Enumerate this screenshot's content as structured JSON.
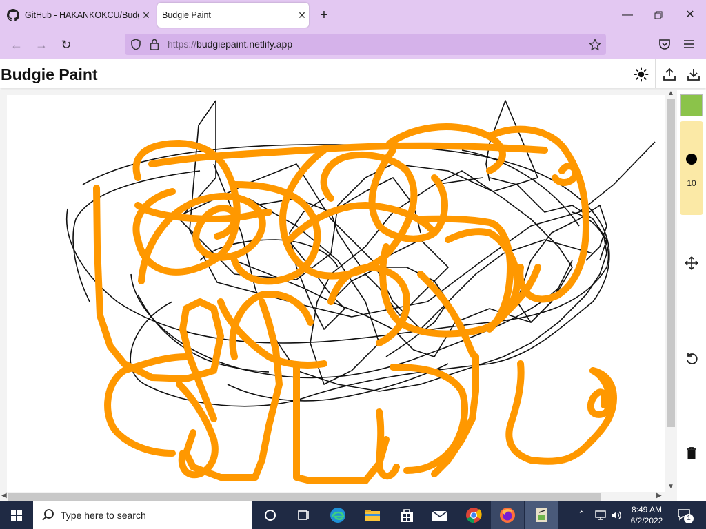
{
  "browser": {
    "tabs": [
      {
        "label": "GitHub - HAKANKOKCU/Budgie",
        "active": false
      },
      {
        "label": "Budgie Paint",
        "active": true
      }
    ],
    "url_proto": "https://",
    "url_host": "budgiepaint.netlify.app"
  },
  "app": {
    "title": "Budgie Paint",
    "brush_size": "10",
    "current_color": "#8bc34a",
    "stroke_color": "#ff9800"
  },
  "toolbar_icons": [
    "color-swatch",
    "brush-size",
    "move-icon",
    "undo-icon",
    "trash-icon"
  ],
  "header_icons": [
    "theme-toggle-icon",
    "upload-icon",
    "download-icon"
  ],
  "taskbar": {
    "search_placeholder": "Type here to search",
    "time": "8:49 AM",
    "date": "6/2/2022",
    "notification_count": "1"
  }
}
